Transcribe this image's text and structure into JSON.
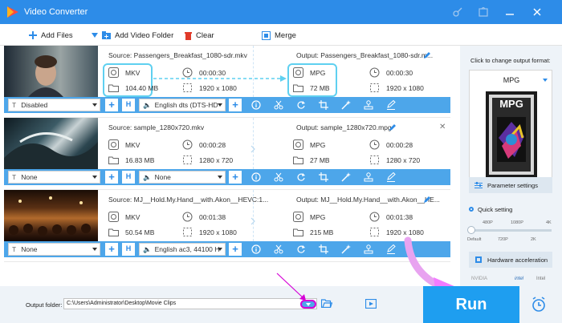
{
  "app": {
    "title": "Video Converter"
  },
  "toolbar": {
    "add_files": "Add Files",
    "add_folder": "Add Video Folder",
    "clear": "Clear",
    "merge": "Merge"
  },
  "files": [
    {
      "source": "Source: Passengers_Breakfast_1080-sdr.mkv",
      "output": "Output: Passengers_Breakfast_1080-sdr.m...",
      "src_format": "MKV",
      "src_duration": "00:00:30",
      "src_size": "104.40 MB",
      "src_resolution": "1920 x 1080",
      "out_format": "MPG",
      "out_duration": "00:00:30",
      "out_size": "72 MB",
      "out_resolution": "1920 x 1080",
      "subtitle": "Disabled",
      "audio": "English dts (DTS-HD"
    },
    {
      "source": "Source: sample_1280x720.mkv",
      "output": "Output: sample_1280x720.mpg",
      "src_format": "MKV",
      "src_duration": "00:00:28",
      "src_size": "16.83 MB",
      "src_resolution": "1280 x 720",
      "out_format": "MPG",
      "out_duration": "00:00:28",
      "out_size": "27 MB",
      "out_resolution": "1280 x 720",
      "subtitle": "None",
      "audio": "None"
    },
    {
      "source": "Source: MJ__Hold.My.Hand__with.Akon__HEVC:1...",
      "output": "Output: MJ__Hold.My.Hand__with.Akon__HE...",
      "src_format": "MKV",
      "src_duration": "00:01:38",
      "src_size": "50.54 MB",
      "src_resolution": "1920 x 1080",
      "out_format": "MPG",
      "out_duration": "00:01:38",
      "out_size": "215 MB",
      "out_resolution": "1920 x 1080",
      "subtitle": "None",
      "audio": "English ac3, 44100 H"
    }
  ],
  "right_panel": {
    "change_label": "Click to change output format:",
    "format": "MPG",
    "format_icon_text": "MPG",
    "parameter_settings": "Parameter settings",
    "quick_setting": "Quick setting",
    "ticks_top": [
      "480P",
      "1080P",
      "4K"
    ],
    "ticks_bottom": [
      "Default",
      "720P",
      "2K"
    ],
    "hardware_acceleration": "Hardware acceleration",
    "gpu_logos": [
      "NVIDIA",
      "intel",
      "Intel"
    ]
  },
  "bottom": {
    "output_folder_label": "Output folder:",
    "output_folder_value": "C:\\Users\\Administrator\\Desktop\\Movie Clips",
    "run": "Run"
  },
  "colors": {
    "accent": "#2d8ce8",
    "strip": "#4da6ea",
    "run": "#1e9ef0",
    "highlight": "#5fd0f0",
    "annotation": "#d600d6"
  }
}
